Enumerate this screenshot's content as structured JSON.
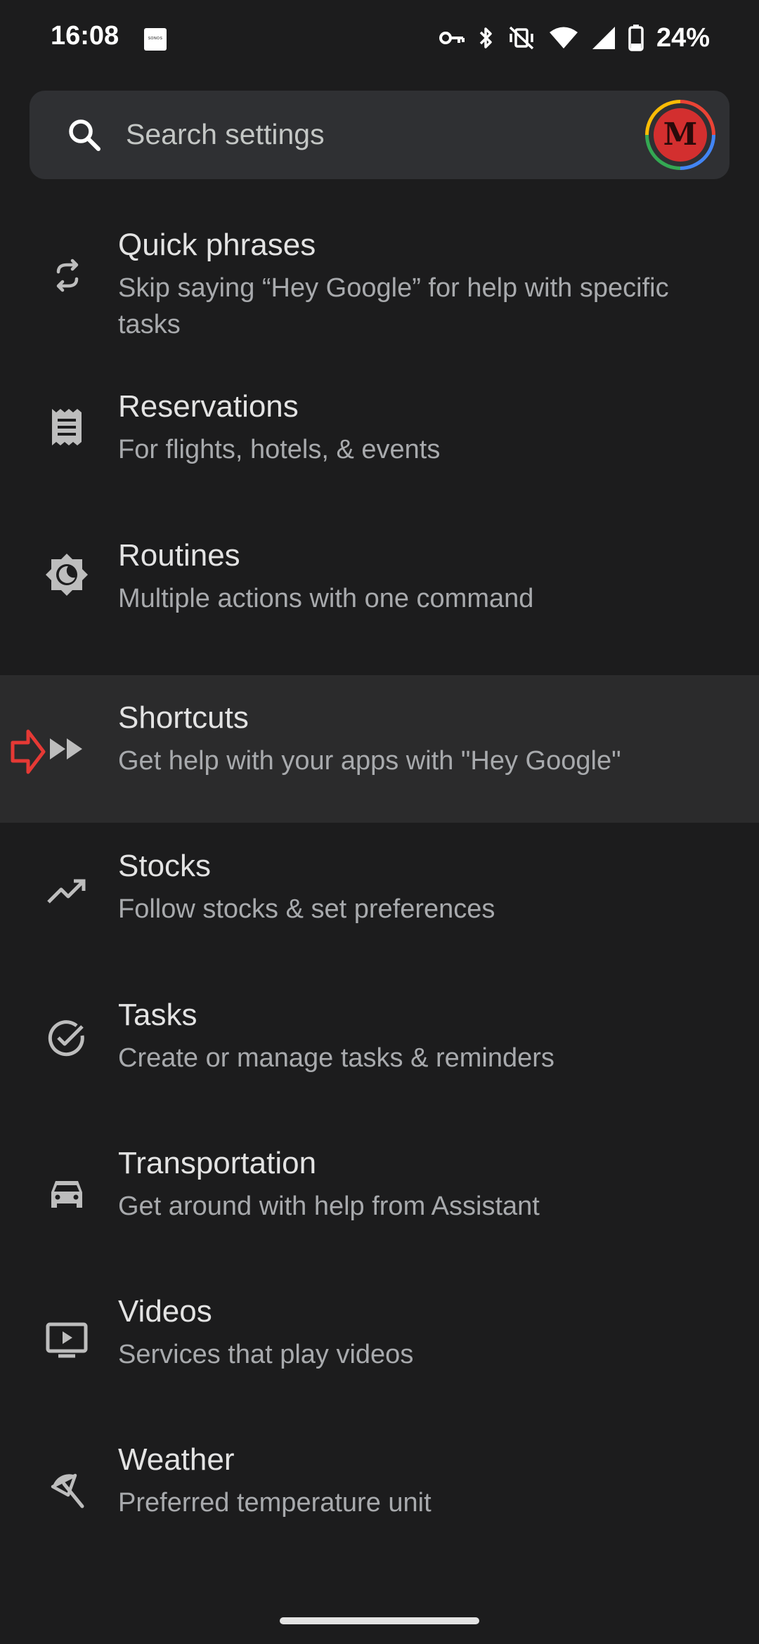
{
  "status_bar": {
    "time": "16:08",
    "notification_badge": "SONOS",
    "battery": "24%",
    "icons": [
      "vpn-key-icon",
      "bluetooth-icon",
      "vibrate-off-icon",
      "wifi-icon",
      "signal-icon",
      "battery-icon"
    ]
  },
  "search": {
    "placeholder": "Search settings",
    "icon": "search-icon",
    "avatar_letter": "M"
  },
  "settings": [
    {
      "title": "Quick phrases",
      "subtitle": "Skip saying “Hey Google” for help with specific tasks",
      "icon": "quick-phrases-icon"
    },
    {
      "title": "Reservations",
      "subtitle": "For flights, hotels, & events",
      "icon": "receipt-icon"
    },
    {
      "title": "Routines",
      "subtitle": "Multiple actions with one command",
      "icon": "routines-icon"
    },
    {
      "title": "Shortcuts",
      "subtitle": "Get help with your apps with \"Hey Google\"",
      "icon": "fast-forward-icon",
      "highlighted": true
    },
    {
      "title": "Stocks",
      "subtitle": "Follow stocks & set preferences",
      "icon": "trending-up-icon"
    },
    {
      "title": "Tasks",
      "subtitle": "Create or manage tasks & reminders",
      "icon": "check-circle-icon"
    },
    {
      "title": "Transportation",
      "subtitle": "Get around with help from Assistant",
      "icon": "car-icon"
    },
    {
      "title": "Videos",
      "subtitle": "Services that play videos",
      "icon": "tv-play-icon"
    },
    {
      "title": "Weather",
      "subtitle": "Preferred temperature unit",
      "icon": "beach-umbrella-icon"
    }
  ],
  "colors": {
    "background": "#1c1c1d",
    "search_bg": "#2f3033",
    "highlight_bg": "#2b2b2c",
    "pointer_arrow": "#e53935"
  }
}
